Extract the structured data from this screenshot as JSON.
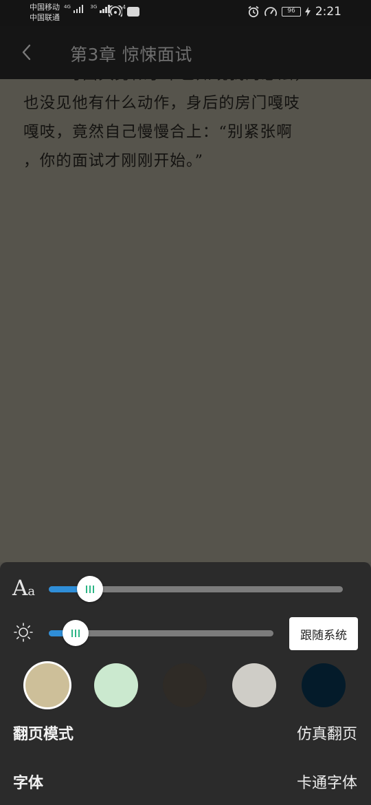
{
  "status_bar": {
    "carrier_1": "中国移动",
    "carrier_2": "中国联通",
    "network_1": "4G",
    "network_2": "3G",
    "hotspot_sup": "4",
    "battery": "96",
    "time": "2:21"
  },
  "header": {
    "back_icon": "chevron-left-icon",
    "title": "第3章 惊悚面试"
  },
  "content": {
    "partial_line": "可面具男似乎早已知晓我的想法，",
    "lines": [
      "也没见他有什么动作，身后的房门嘎吱",
      "嘎吱，竟然自己慢慢合上：“别紧张啊",
      "，你的面试才刚刚开始。”"
    ]
  },
  "settings": {
    "font_size_icon_big": "A",
    "font_size_icon_small": "a",
    "font_size_level": 0.14,
    "brightness_level": 0.12,
    "follow_system_label": "跟随系统",
    "accent_color": "#2f8ed8",
    "background_swatches": [
      {
        "color": "#cdbf99",
        "selected": true
      },
      {
        "color": "#cbe9cf",
        "selected": false
      },
      {
        "color": "#2f2b26",
        "selected": false
      },
      {
        "color": "#cfcdc7",
        "selected": false
      },
      {
        "color": "#041b2a",
        "selected": false
      }
    ],
    "page_mode_label": "翻页模式",
    "page_mode_value": "仿真翻页",
    "font_label": "字体",
    "font_value": "卡通字体"
  }
}
